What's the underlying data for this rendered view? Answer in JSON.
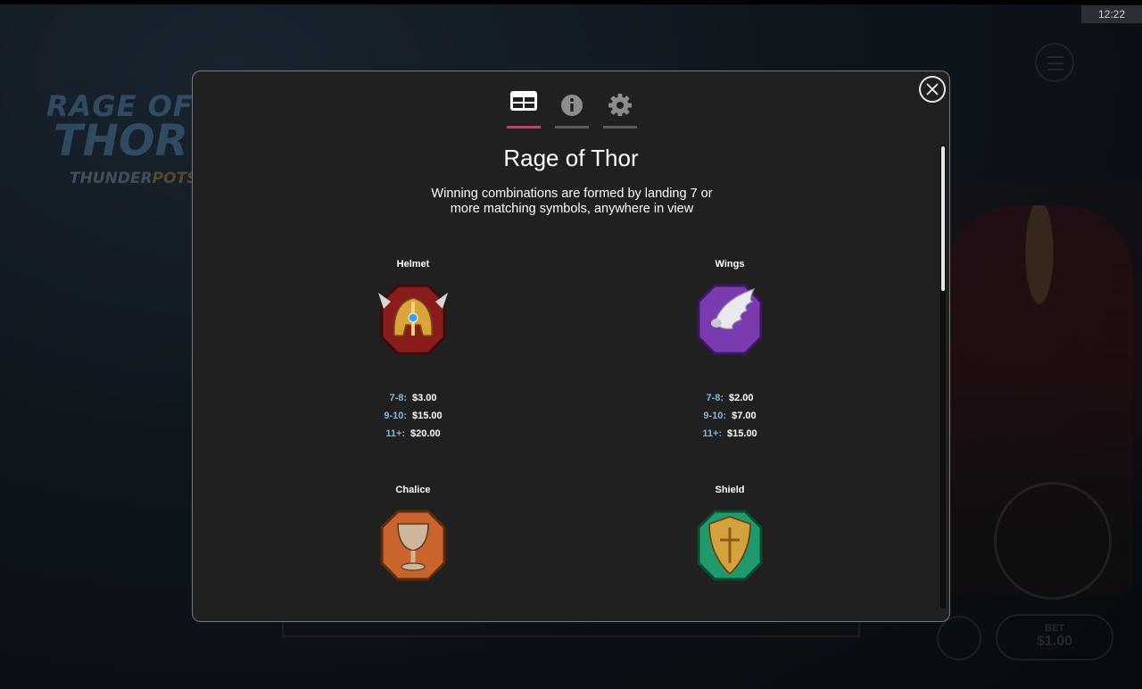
{
  "clock": "12:22",
  "background": {
    "logo_line1": "RAGE OF",
    "logo_line2": "THOR",
    "logo_sub_a": "THUNDER",
    "logo_sub_b": "POTS",
    "bet_label": "BET",
    "bet_value": "$1.00"
  },
  "modal": {
    "tabs": [
      {
        "id": "paytable",
        "icon": "paytable-icon",
        "active": true
      },
      {
        "id": "info",
        "icon": "info-icon",
        "active": false
      },
      {
        "id": "settings",
        "icon": "gear-icon",
        "active": false
      }
    ],
    "title": "Rage of Thor",
    "description": "Winning combinations are formed by landing 7 or more matching symbols, anywhere in view",
    "symbols": [
      {
        "name": "Helmet",
        "icon": "helmet-icon",
        "pays": [
          {
            "count": "7-8:",
            "amount": "$3.00"
          },
          {
            "count": "9-10:",
            "amount": "$15.00"
          },
          {
            "count": "11+:",
            "amount": "$20.00"
          }
        ]
      },
      {
        "name": "Wings",
        "icon": "wings-icon",
        "pays": [
          {
            "count": "7-8:",
            "amount": "$2.00"
          },
          {
            "count": "9-10:",
            "amount": "$7.00"
          },
          {
            "count": "11+:",
            "amount": "$15.00"
          }
        ]
      },
      {
        "name": "Chalice",
        "icon": "chalice-icon",
        "pays": []
      },
      {
        "name": "Shield",
        "icon": "shield-icon",
        "pays": []
      }
    ]
  },
  "colors": {
    "accent": "#c0426c",
    "pay_count": "#84b3d8",
    "modal_bg": "#202020",
    "helmet_frame": "#8a1c1c",
    "wings_frame": "#7a3bb0",
    "chalice_frame": "#c9642d",
    "shield_frame": "#1f9a6c"
  }
}
